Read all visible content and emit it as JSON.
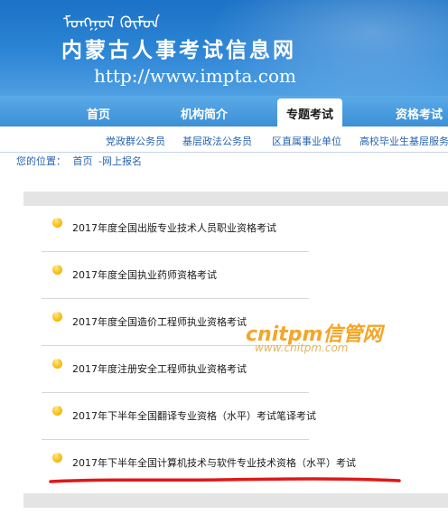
{
  "header": {
    "mongolian_text": "ᠮᠣᠩᠭᠣᠯ ᠬᠦᠮᠦᠨ",
    "title": "内蒙古人事考试信息网",
    "url": "http://www.impta.com"
  },
  "nav": {
    "items": [
      "首页",
      "机构简介",
      "专题考试",
      "资格考试"
    ],
    "active": "专题考试"
  },
  "subnav": {
    "items": [
      "党政群公务员",
      "基层政法公务员",
      "区直属事业单位",
      "高校毕业生基层服务"
    ]
  },
  "breadcrumb": {
    "prefix": "您的位置：",
    "home": "首页",
    "current": "-网上报名"
  },
  "exam_list": [
    "2017年度全国出版专业技术人员职业资格考试",
    "2017年度全国执业药师资格考试",
    "2017年度全国造价工程师执业资格考试",
    "2017年度注册安全工程师执业资格考试",
    "2017年下半年全国翻译专业资格（水平）考试笔译考试",
    "2017年下半年全国计算机技术与软件专业技术资格（水平）考试"
  ],
  "watermark": {
    "main": "cnitpm信管网",
    "url": "www.cnitpm.com"
  },
  "colors": {
    "banner": "#2e86d6",
    "nav": "#3d8fd6",
    "link": "#2a64b0",
    "watermark": "#f3a62a",
    "underline": "#e01818"
  }
}
